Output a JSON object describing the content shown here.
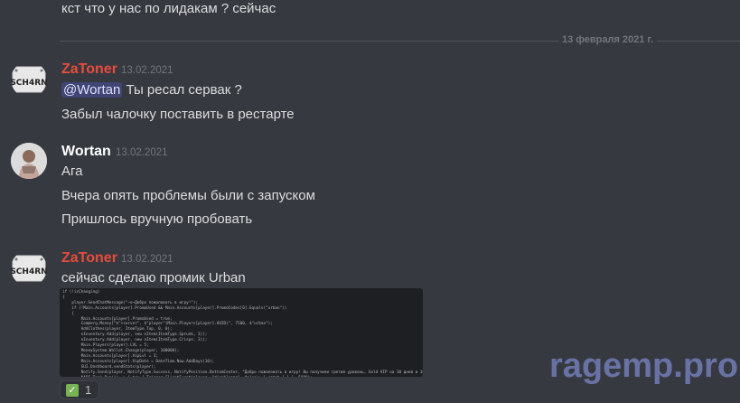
{
  "top_message": "кст что у нас по лидакам ? сейчас",
  "divider": {
    "label": "13 февраля 2021 г."
  },
  "messages": [
    {
      "author": "ZaToner",
      "timestamp": "13.02.2021",
      "author_color": "#e74c3c",
      "avatar_text": "SCH4RN",
      "mention": "@Wortan",
      "lines": [
        "Ты ресал сервак ?",
        "Забыл чалочку поставить в рестарте"
      ]
    },
    {
      "author": "Wortan",
      "timestamp": "13.02.2021",
      "author_color": "#ffffff",
      "lines": [
        "Ага",
        "Вчера опять проблемы были с запуском",
        "Пришлось вручную пробовать"
      ]
    },
    {
      "author": "ZaToner",
      "timestamp": "13.02.2021",
      "author_color": "#e74c3c",
      "avatar_text": "SCH4RN",
      "lines": [
        "сейчас сделаю промик Urban"
      ],
      "attachment_code": [
        "if (!isChanging)",
        "{",
        "    player.SendChatMessage(\"~o~Добро пожаловать в игру!\");",
        "    if (!Main.Accounts[player].PromoUsed && Main.Accounts[player].PromoCodes[0].Equals(\"urban\"))",
        "    {",
        "        Main.Accounts[player].PromoUsed = true;",
        "        Commerg.Money[\"$\"+server\", $\"player\"(Main.Players[player].UUID)\", 7500, $\"urban\");",
        "        AddClothes(player, ItemType.Top, 0, 0);",
        "        nInventory.Add(player, new nItem(ItemType.Sprunk, 3));",
        "        nInventory.Add(player, new nItem(ItemType.Crisps, 3));",
        "        Main.Players[player].LVL = 5;",
        "        MoneySystem.Wallet.Change(player, 100000);",
        "        Main.Accounts[player].VipLvl = 3;",
        "        Main.Accounts[player].VipDate = DateTime.Now.AddDays(10);",
        "        GUI.Dashboard.sendStats(player);",
        "        Notify.Send(player, NotifyType.Success, NotifyPosition.BottomCenter, \"Добро пожаловать в игру! Вы получили третий уровень, Gold VIP на 10 дней и 100000$!\", 6000);",
        "        NAPI.Task.Run(() => { try { Trigger.ClientEvent(player, \"disableamg\", false); } catch { } }, 5000);",
        "    }",
        "}"
      ],
      "reaction": {
        "emoji": "✓",
        "emoji_name": "check-mark-icon",
        "count": "1"
      }
    }
  ],
  "watermark": "ragemp.pro"
}
